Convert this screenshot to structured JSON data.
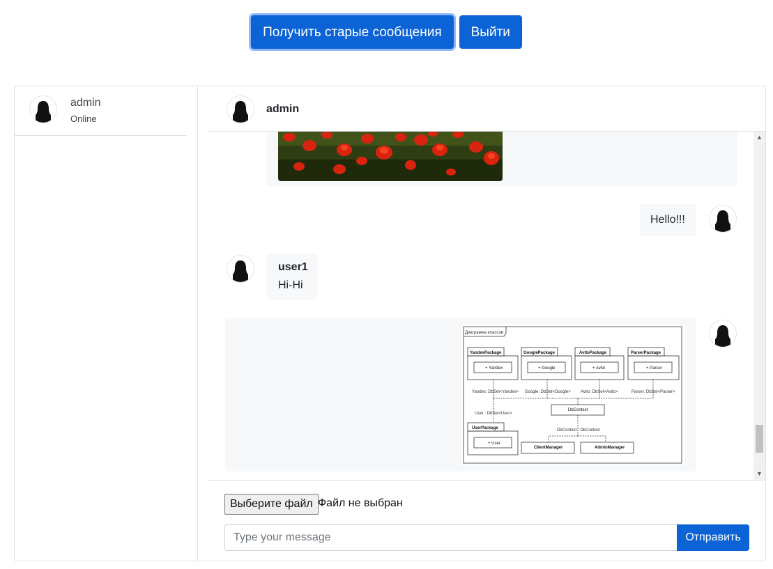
{
  "toolbar": {
    "load_old_label": "Получить старые сообщения",
    "logout_label": "Выйти"
  },
  "sidebar": {
    "contacts": [
      {
        "name": "admin",
        "status": "Online"
      }
    ]
  },
  "chat": {
    "header_name": "admin",
    "messages": [
      {
        "kind": "image",
        "content": "poppy-field-photo",
        "side": "left"
      },
      {
        "kind": "text",
        "text": "Hello!!!",
        "side": "right"
      },
      {
        "kind": "text",
        "author": "user1",
        "text": "Hi-Hi",
        "side": "left"
      },
      {
        "kind": "image",
        "content": "class-diagram",
        "side": "right"
      }
    ],
    "diagram": {
      "title": "Диаграмма классов",
      "packages": [
        {
          "name": "YandexPackage",
          "member": "+ Yandex"
        },
        {
          "name": "GooglePackage",
          "member": "+ Google"
        },
        {
          "name": "AvitoPackage",
          "member": "+ Avito"
        },
        {
          "name": "ParserPackage",
          "member": "+ Parser"
        },
        {
          "name": "UserPackage",
          "member": "+ User"
        }
      ],
      "labels": {
        "yandex": "Yandex: DbSet<Yandex>",
        "google": "Google: DbSet<Google>",
        "avito": "Avito: DbSet<Avito>",
        "parser": "Parser: DbSet<Parser>",
        "user": "User : DbSet<User>",
        "dbcontext": "DbContext : DbContext"
      },
      "classes": [
        "DbContext",
        "ClientManager",
        "AdminManager"
      ]
    }
  },
  "compose": {
    "file_button_label": "Выберите файл",
    "file_status": "Файл не выбран",
    "message_placeholder": "Type your message",
    "send_label": "Отправить"
  }
}
